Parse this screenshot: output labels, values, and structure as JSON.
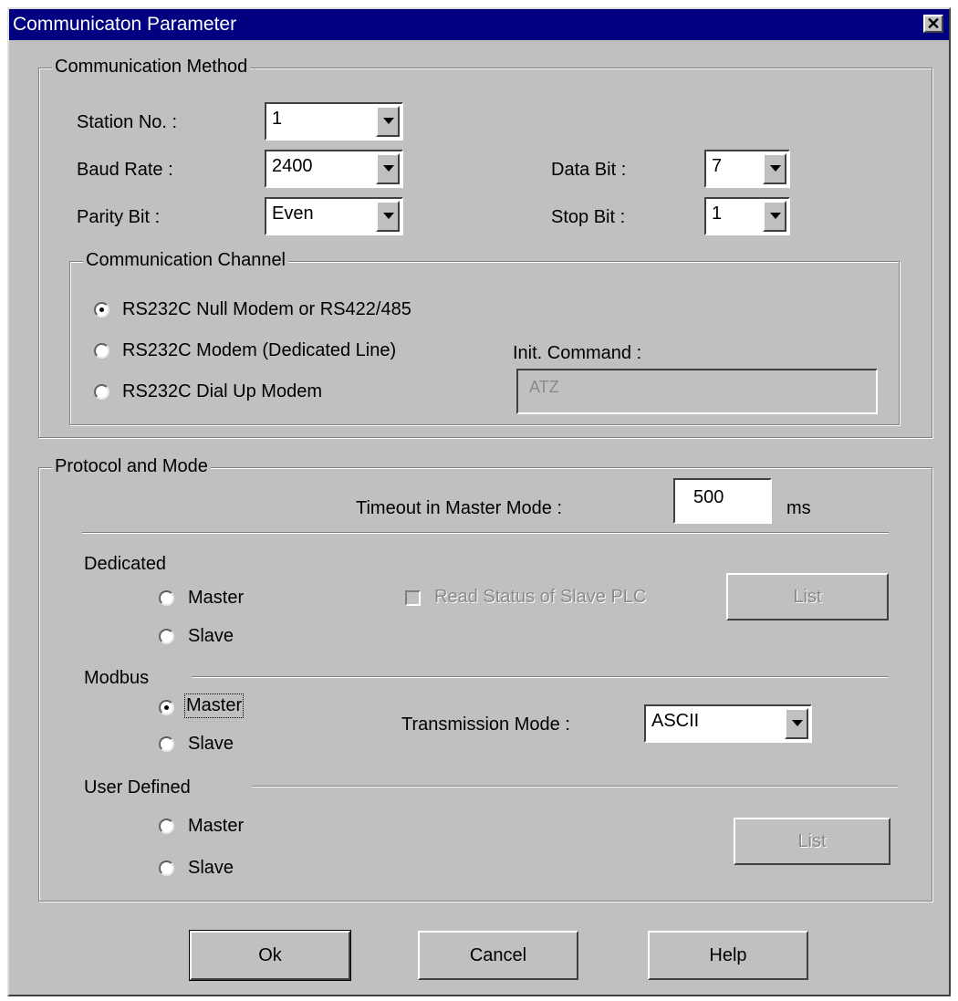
{
  "window": {
    "title": "Communicaton Parameter",
    "close_glyph": "✕"
  },
  "method": {
    "title": "Communication Method",
    "station_label": "Station No. :",
    "station_value": "1",
    "baud_label": "Baud Rate :",
    "baud_value": "2400",
    "parity_label": "Parity Bit :",
    "parity_value": "Even",
    "databit_label": "Data Bit :",
    "databit_value": "7",
    "stopbit_label": "Stop Bit :",
    "stopbit_value": "1"
  },
  "channel": {
    "title": "Communication Channel",
    "options": [
      "RS232C Null Modem or RS422/485",
      "RS232C Modem (Dedicated Line)",
      "RS232C Dial Up Modem"
    ],
    "selected": 0,
    "init_label": "Init. Command :",
    "init_value": "ATZ"
  },
  "protocol": {
    "title": "Protocol and Mode",
    "timeout_label": "Timeout in Master Mode :",
    "timeout_value": "500",
    "timeout_unit": "ms",
    "dedicated_label": "Dedicated",
    "modbus_label": "Modbus",
    "user_label": "User Defined",
    "master": "Master",
    "slave": "Slave",
    "read_status_label": "Read Status of Slave PLC",
    "list_label": "List",
    "transmission_label": "Transmission Mode :",
    "transmission_value": "ASCII"
  },
  "buttons": {
    "ok": "Ok",
    "cancel": "Cancel",
    "help": "Help"
  },
  "colors": {
    "titlebar": "#000080",
    "face": "#c0c0c0"
  }
}
